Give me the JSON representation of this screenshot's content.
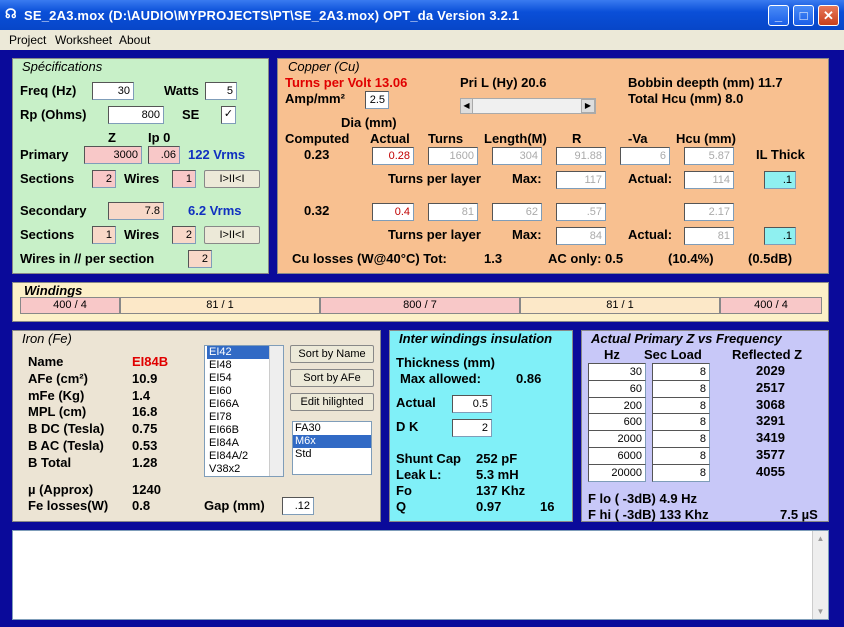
{
  "window": {
    "title": "SE_2A3.mox  (D:\\AUDIO\\MYPROJECTS\\PT\\SE_2A3.mox)  OPT_da Version 3.2.1",
    "min": "_",
    "max": "□",
    "close": "✕"
  },
  "menu": [
    "Project",
    "Worksheet",
    "About"
  ],
  "spec": {
    "title": "Spécifications",
    "freq_label": "Freq (Hz)",
    "freq": "30",
    "watts_label": "Watts",
    "watts": "5",
    "rp_label": "Rp (Ohms)",
    "rp": "800",
    "se_label": "SE",
    "se_check": "✓",
    "z_label": "Z",
    "ip0_label": "Ip 0",
    "primary_label": "Primary",
    "primary_z": "3000",
    "primary_ip0": ".06",
    "primary_vrms": "122 Vrms",
    "sections_label": "Sections",
    "wires_label": "Wires",
    "p_sections": "2",
    "p_wires": "1",
    "seq_btn": "I>II<I",
    "secondary_label": "Secondary",
    "secondary_z": "7.8",
    "secondary_vrms": "6.2 Vrms",
    "s_sections": "1",
    "s_wires": "2",
    "wires_par_label": "Wires in // per section",
    "wires_par": "2"
  },
  "copper": {
    "title": "Copper (Cu)",
    "tpv": "Turns per Volt  13.06",
    "amp_label": "Amp/mm²",
    "amp": "2.5",
    "pril": "Pri L (Hy)  20.6",
    "bobbin": "Bobbin deepth (mm) 11.7",
    "hcu": "Total Hcu (mm)         8.0",
    "dia_label": "Dia (mm)",
    "computed": "Computed",
    "actual": "Actual",
    "turns": "Turns",
    "length": "Length(M)",
    "r": "R",
    "va": "-Va",
    "hcu_col": "Hcu (mm)",
    "ilthick": "IL Thick",
    "p_comp": "0.23",
    "p_act": "0.28",
    "p_turns": "1600",
    "p_len": "304",
    "p_r": "91.88",
    "p_va": "6",
    "p_hcu": "5.87",
    "tpl": "Turns per layer",
    "max": "Max:",
    "act_lbl": "Actual:",
    "p_max": "117",
    "p_actual": "114",
    "p_il": ".1",
    "s_comp": "0.32",
    "s_act": "0.4",
    "s_turns": "81",
    "s_len": "62",
    "s_r": ".57",
    "s_hcu": "2.17",
    "s_max": "84",
    "s_actual": "81",
    "s_il": ".1",
    "losses": "Cu losses (W@40°C)  Tot:",
    "tot": "1.3",
    "ac": "AC only:  0.5",
    "pct": "(10.4%)",
    "db": "(0.5dB)"
  },
  "windings": {
    "title": "Windings",
    "segs": [
      "400 / 4",
      "81 / 1",
      "800 / 7",
      "81 / 1",
      "400 / 4"
    ]
  },
  "iron": {
    "title": "Iron (Fe)",
    "rows": [
      [
        "Name",
        "EI84B"
      ],
      [
        "AFe (cm²)",
        "10.9"
      ],
      [
        "mFe (Kg)",
        "1.4"
      ],
      [
        "MPL (cm)",
        "16.8"
      ],
      [
        "B DC (Tesla)",
        "0.75"
      ],
      [
        "B AC (Tesla)",
        "0.53"
      ],
      [
        "B Total",
        "1.28"
      ]
    ],
    "mu_label": "µ (Approx)",
    "mu": "1240",
    "fel_label": "Fe losses(W)",
    "fel": "0.8",
    "gap_label": "Gap (mm)",
    "gap": ".12",
    "cores": [
      "EI42",
      "EI48",
      "EI54",
      "EI60",
      "EI66A",
      "EI78",
      "EI66B",
      "EI84A",
      "EI84A/2",
      "V38x2"
    ],
    "sort_name": "Sort by Name",
    "sort_afe": "Sort by AFe",
    "edit": "Edit hilighted",
    "mats": [
      "FA30",
      "M6x",
      "Std"
    ]
  },
  "ins": {
    "title": "Inter windings insulation",
    "thick": "Thickness (mm)",
    "maxa": "Max allowed:",
    "maxv": "0.86",
    "actual": "Actual",
    "actv": "0.5",
    "dk": "D K",
    "dkv": "2",
    "rows": [
      [
        "Shunt Cap",
        "252 pF"
      ],
      [
        "Leak L:",
        "5.3 mH"
      ],
      [
        "Fo",
        "137 Khz"
      ],
      [
        "Q",
        "0.97"
      ]
    ],
    "q2": "16"
  },
  "freq": {
    "title": "Actual Primary Z vs Frequency",
    "hz": "Hz",
    "sec": "Sec Load",
    "refl": "Reflected Z",
    "rows": [
      [
        "30",
        "8",
        "2029"
      ],
      [
        "60",
        "8",
        "2517"
      ],
      [
        "200",
        "8",
        "3068"
      ],
      [
        "600",
        "8",
        "3291"
      ],
      [
        "2000",
        "8",
        "3419"
      ],
      [
        "6000",
        "8",
        "3577"
      ],
      [
        "20000",
        "8",
        "4055"
      ]
    ],
    "flo": "F lo ( -3dB) 4.9 Hz",
    "fhi": "F hi ( -3dB) 133 Khz",
    "us": "7.5 µS"
  },
  "scroll": {
    "up": "▲",
    "down": "▼"
  }
}
